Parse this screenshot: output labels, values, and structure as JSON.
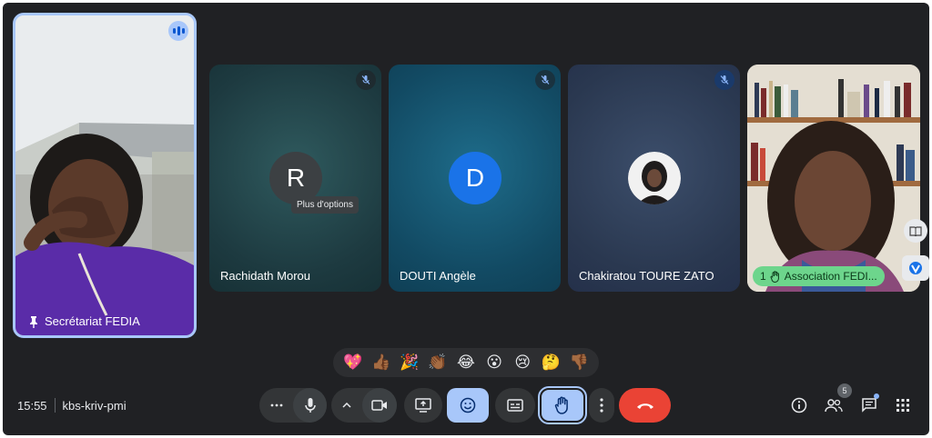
{
  "participants": {
    "pinned": {
      "name": "Secrétariat FEDIA",
      "pin_icon": "pin-icon",
      "audio_icon": "audio-level-icon"
    },
    "tile_r": {
      "name": "Rachidath Morou",
      "initial": "R",
      "avatar_color": "#3c4043",
      "muted_icon": "mic-off-icon"
    },
    "tile_d": {
      "name": "DOUTI Angèle",
      "initial": "D",
      "avatar_color": "#1a73e8",
      "muted_icon": "mic-off-icon"
    },
    "tile_c": {
      "name": "Chakiratou TOURE ZATO",
      "muted_icon": "mic-off-icon"
    },
    "tile_a": {
      "name": "Association FEDI...",
      "hand_count": "1",
      "hand_icon": "raised-hand-icon"
    }
  },
  "tooltip": {
    "text": "Plus d'options"
  },
  "reactions": [
    "💖",
    "👍🏾",
    "🎉",
    "👏🏾",
    "😂",
    "😮",
    "😢",
    "🤔",
    "👎🏾"
  ],
  "meeting": {
    "time": "15:55",
    "code": "kbs-kriv-pmi"
  },
  "controls": {
    "more_options_icon": "more-horiz-icon",
    "mic_icon": "mic-icon",
    "chevron_icon": "chevron-up-icon",
    "camera_icon": "videocam-icon",
    "present_icon": "present-screen-icon",
    "emoji_icon": "emoji-icon",
    "captions_icon": "captions-icon",
    "hand_icon": "raised-hand-icon",
    "more_vert_icon": "more-vert-icon",
    "end_call_icon": "call-end-icon"
  },
  "right_controls": {
    "info_icon": "info-icon",
    "people_icon": "people-icon",
    "people_count": "5",
    "chat_icon": "chat-icon",
    "activities_icon": "apps-icon"
  },
  "colors": {
    "background": "#202124",
    "accent": "#a8c7fa",
    "end_call": "#ea4335",
    "hand_chip": "#6dd58c"
  }
}
